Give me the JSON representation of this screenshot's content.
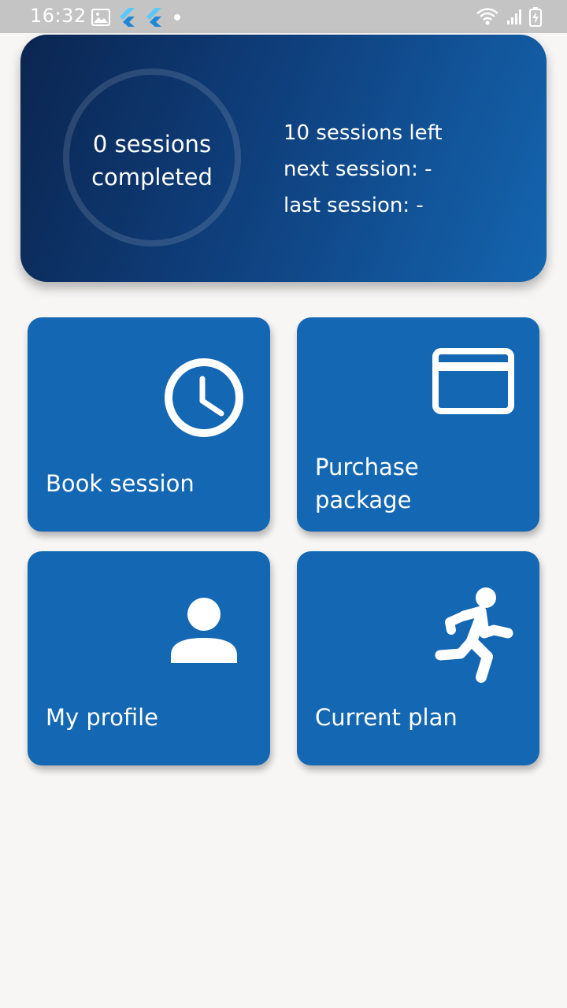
{
  "status_bar": {
    "time": "16:32",
    "left_icons": [
      "image-icon",
      "flutter-icon",
      "flutter-icon",
      "dot-icon"
    ],
    "right_icons": [
      "wifi-icon",
      "signal-icon",
      "battery-charging-icon"
    ]
  },
  "summary": {
    "completed_line1": "0 sessions",
    "completed_line2": "completed",
    "sessions_left": "10 sessions left",
    "next_session": "next session: -",
    "last_session": "last session: -"
  },
  "tiles": [
    {
      "label_lines": [
        "Book session"
      ],
      "icon": "clock-icon"
    },
    {
      "label_lines": [
        "Purchase",
        "package"
      ],
      "icon": "credit-card-icon"
    },
    {
      "label_lines": [
        "My profile"
      ],
      "icon": "person-icon"
    },
    {
      "label_lines": [
        "Current plan"
      ],
      "icon": "running-icon"
    }
  ],
  "colors": {
    "tile": "#1467b3",
    "card_gradient_start": "#0b2550",
    "card_gradient_end": "#1465b0",
    "background": "#f7f6f5",
    "status_bar": "#c4c4c4"
  }
}
